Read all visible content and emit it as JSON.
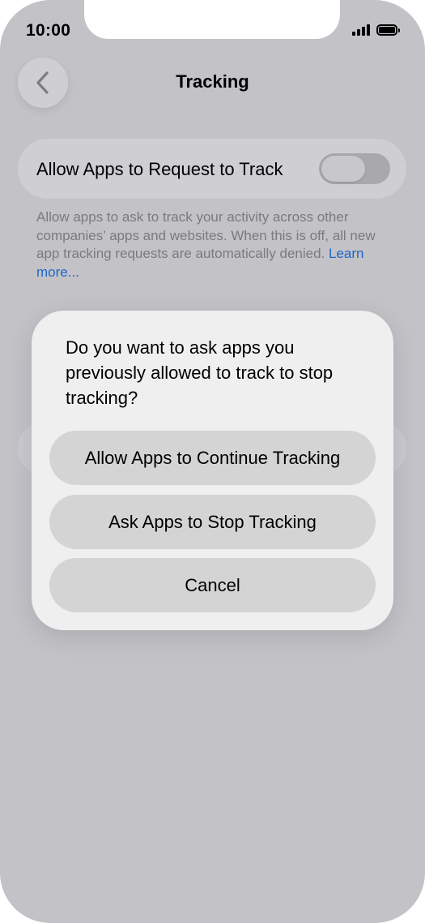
{
  "status_bar": {
    "time": "10:00",
    "signal_icon": "signal-bars-icon",
    "battery_icon": "battery-full-icon"
  },
  "nav": {
    "back_icon": "chevron-left-icon",
    "title": "Tracking"
  },
  "settings": {
    "toggle_label": "Allow Apps to Request to Track",
    "toggle_on": false,
    "footnote": "Allow apps to ask to track your activity across other companies’ apps and websites. When this is off, all new app tracking requests are automatically denied.",
    "learn_more": "Learn more..."
  },
  "alert": {
    "message": "Do you want to ask apps you previously allowed to track to stop tracking?",
    "continue_label": "Allow Apps to Continue Tracking",
    "stop_label": "Ask Apps to Stop Tracking",
    "cancel_label": "Cancel"
  },
  "colors": {
    "background": "#c3c2c7",
    "alert_background": "#efefef",
    "button_background": "#d4d4d4",
    "link": "#1c66c8"
  }
}
